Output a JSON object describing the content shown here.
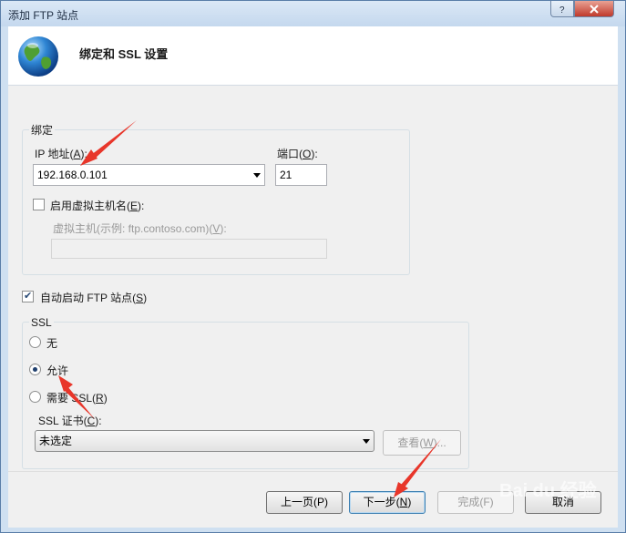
{
  "window": {
    "title": "添加 FTP 站点"
  },
  "header": {
    "title": "绑定和 SSL 设置"
  },
  "binding": {
    "group_label": "绑定",
    "ip_label_prefix": "IP 地址(",
    "ip_label_key": "A",
    "ip_label_suffix": "):",
    "ip_value": "192.168.0.101",
    "port_label_prefix": "端口(",
    "port_label_key": "O",
    "port_label_suffix": "):",
    "port_value": "21",
    "vhost_checkbox_prefix": "启用虚拟主机名(",
    "vhost_checkbox_key": "E",
    "vhost_checkbox_suffix": "):",
    "vhost_checked": false,
    "vhost_label_prefix": "虚拟主机(示例: ftp.contoso.com)(",
    "vhost_label_key": "V",
    "vhost_label_suffix": "):",
    "vhost_value": ""
  },
  "autostart": {
    "prefix": "自动启动 FTP 站点(",
    "key": "S",
    "suffix": ")",
    "checked": true
  },
  "ssl": {
    "group_label": "SSL",
    "options": [
      {
        "label": "无",
        "checked": false
      },
      {
        "label": "允许",
        "checked": true
      },
      {
        "label": "需要 SSL(",
        "key": "R",
        "suffix": ")",
        "checked": false
      }
    ],
    "cert_label_prefix": "SSL 证书(",
    "cert_label_key": "C",
    "cert_label_suffix": "):",
    "cert_value": "未选定",
    "view_button_prefix": "查看(",
    "view_button_key": "W",
    "view_button_suffix": ")..."
  },
  "footer": {
    "prev_label": "上一页(P)",
    "next_prefix": "下一步(",
    "next_key": "N",
    "next_suffix": ")",
    "finish_label": "完成(F)",
    "cancel_label": "取消"
  },
  "annotation_color": "#e8362a"
}
